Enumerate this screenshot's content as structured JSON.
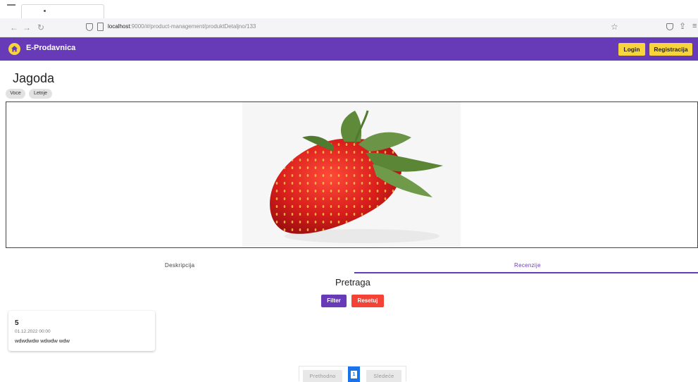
{
  "browser": {
    "url_host": "localhost",
    "url_rest": ":9000/#/product-management/produktDetaljno/133"
  },
  "toolbar": {
    "brand": "E-Prodavnica",
    "login_label": "Login",
    "register_label": "Registracija",
    "accent": "#673ab7",
    "button_color": "#f7d43b"
  },
  "product": {
    "title": "Jagoda",
    "tags": [
      "Voce",
      "Letnje"
    ]
  },
  "tabs": {
    "description": "Deskripcija",
    "reviews": "Recenzije"
  },
  "search": {
    "title": "Pretraga",
    "filter_label": "Filter",
    "reset_label": "Resetuj"
  },
  "reviews": [
    {
      "rating": "5",
      "date": "01.12.2022 00:00",
      "text": "wdwdwdw wdwdw wdw"
    }
  ],
  "pagination": {
    "prev_label": "Prethodno",
    "current_page": "1",
    "next_label": "Sledeće"
  }
}
